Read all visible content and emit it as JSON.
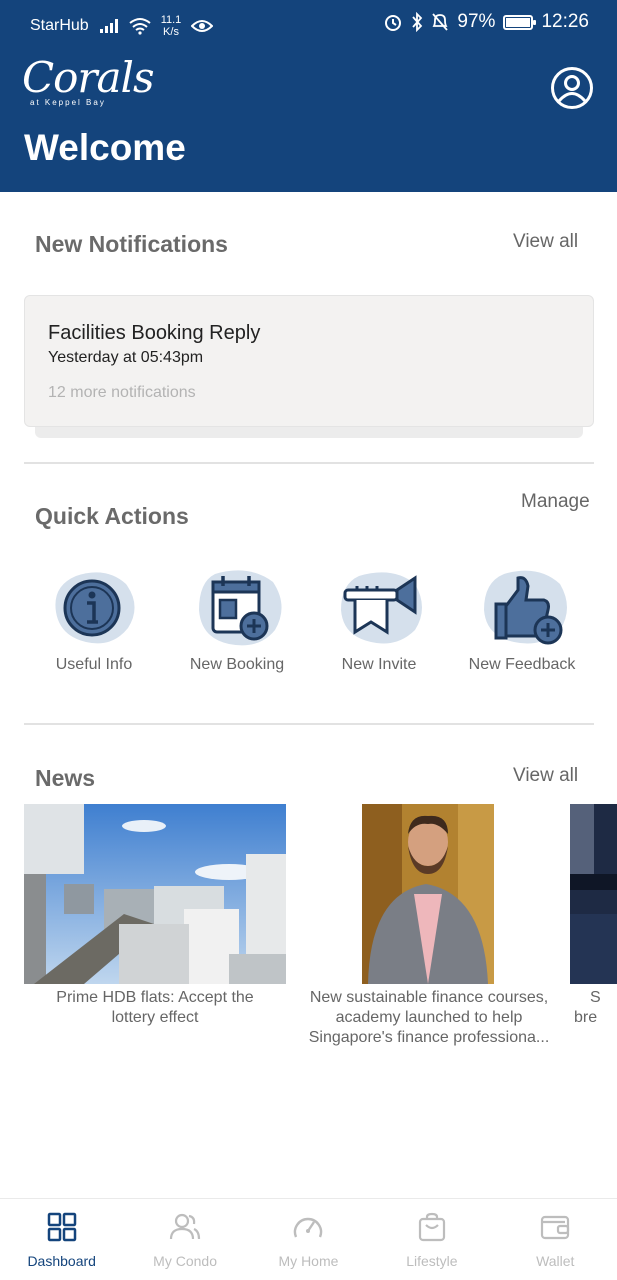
{
  "status_bar": {
    "carrier": "StarHub",
    "net_speed_value": "11.1",
    "net_speed_unit": "K/s",
    "battery": "97%",
    "battery_level": 0.97,
    "time": "12:26"
  },
  "header": {
    "logo_script": "Corals",
    "logo_sub": "at Keppel Bay",
    "welcome": "Welcome",
    "bg_color": "#14447c"
  },
  "notifications": {
    "title": "New Notifications",
    "view_all": "View all",
    "card": {
      "title": "Facilities Booking Reply",
      "time": "Yesterday at 05:43pm",
      "more": "12 more notifications"
    }
  },
  "quick_actions": {
    "title": "Quick Actions",
    "manage": "Manage",
    "items": [
      {
        "label": "Useful Info",
        "icon": "info-icon"
      },
      {
        "label": "New Booking",
        "icon": "calendar-add-icon"
      },
      {
        "label": "New Invite",
        "icon": "trumpet-icon"
      },
      {
        "label": "New Feedback",
        "icon": "thumbs-up-add-icon"
      }
    ]
  },
  "news": {
    "title": "News",
    "view_all": "View all",
    "items": [
      {
        "line1": "Prime HDB flats: Accept the",
        "line2": "lottery effect",
        "line3": ""
      },
      {
        "line1": "New sustainable finance courses,",
        "line2": "academy launched to help",
        "line3": "Singapore's finance professiona..."
      },
      {
        "line1": "S",
        "line2": "bre",
        "line3": ""
      }
    ]
  },
  "bottom_nav": {
    "items": [
      {
        "label": "Dashboard",
        "icon": "grid-icon",
        "active": true
      },
      {
        "label": "My Condo",
        "icon": "people-icon",
        "active": false
      },
      {
        "label": "My Home",
        "icon": "gauge-icon",
        "active": false
      },
      {
        "label": "Lifestyle",
        "icon": "bag-icon",
        "active": false
      },
      {
        "label": "Wallet",
        "icon": "wallet-icon",
        "active": false
      }
    ]
  }
}
